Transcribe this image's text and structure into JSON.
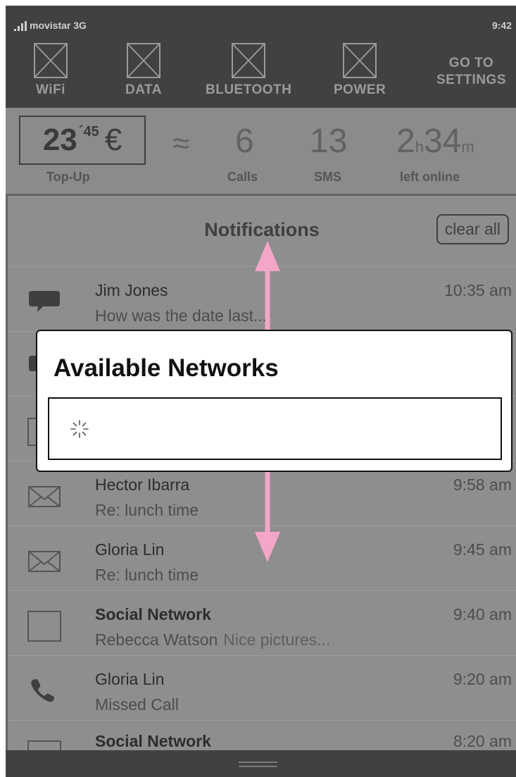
{
  "status": {
    "carrier": "movistar 3G",
    "time": "9:42"
  },
  "quick_settings": {
    "wifi": "WiFi",
    "data": "DATA",
    "bluetooth": "BLUETOOTH",
    "power": "POWER",
    "settings_line1": "GO TO",
    "settings_line2": "SETTINGS"
  },
  "balance": {
    "amount": "23",
    "cents": "´45",
    "currency": "€",
    "topup_label": "Top-Up",
    "approx_symbol": "≈",
    "calls_value": "6",
    "calls_label": "Calls",
    "sms_value": "13",
    "sms_label": "SMS",
    "online_hours": "2",
    "online_hours_unit": "h",
    "online_minutes": "34",
    "online_minutes_unit": "m",
    "online_label": "left online"
  },
  "notifications": {
    "title": "Notifications",
    "clear_all": "clear all",
    "items": [
      {
        "icon": "chat-bubble-icon",
        "name": "Jim Jones",
        "sub": "How was the date last...",
        "time": "10:35 am"
      },
      {
        "icon": "envelope-icon",
        "name": "Hector Ibarra",
        "sub": "Re: lunch time",
        "time": "9:58 am"
      },
      {
        "icon": "envelope-icon",
        "name": "Gloria Lin",
        "sub": "Re: lunch time",
        "time": "9:45 am"
      },
      {
        "icon": "square-icon",
        "name": "Social Network",
        "sub": "Rebecca Watson",
        "snippet": "Nice pictures...",
        "time": "9:40 am"
      },
      {
        "icon": "phone-icon",
        "name": "Gloria Lin",
        "sub": "Missed Call",
        "time": "9:20 am"
      },
      {
        "icon": "square-icon",
        "name": "Social Network",
        "time": "8:20 am"
      }
    ]
  },
  "modal": {
    "title": "Available Networks"
  },
  "colors": {
    "arrow": "#f3a6c8",
    "overlay_gray": "#8e8e8e",
    "dark_bar": "#414141"
  }
}
